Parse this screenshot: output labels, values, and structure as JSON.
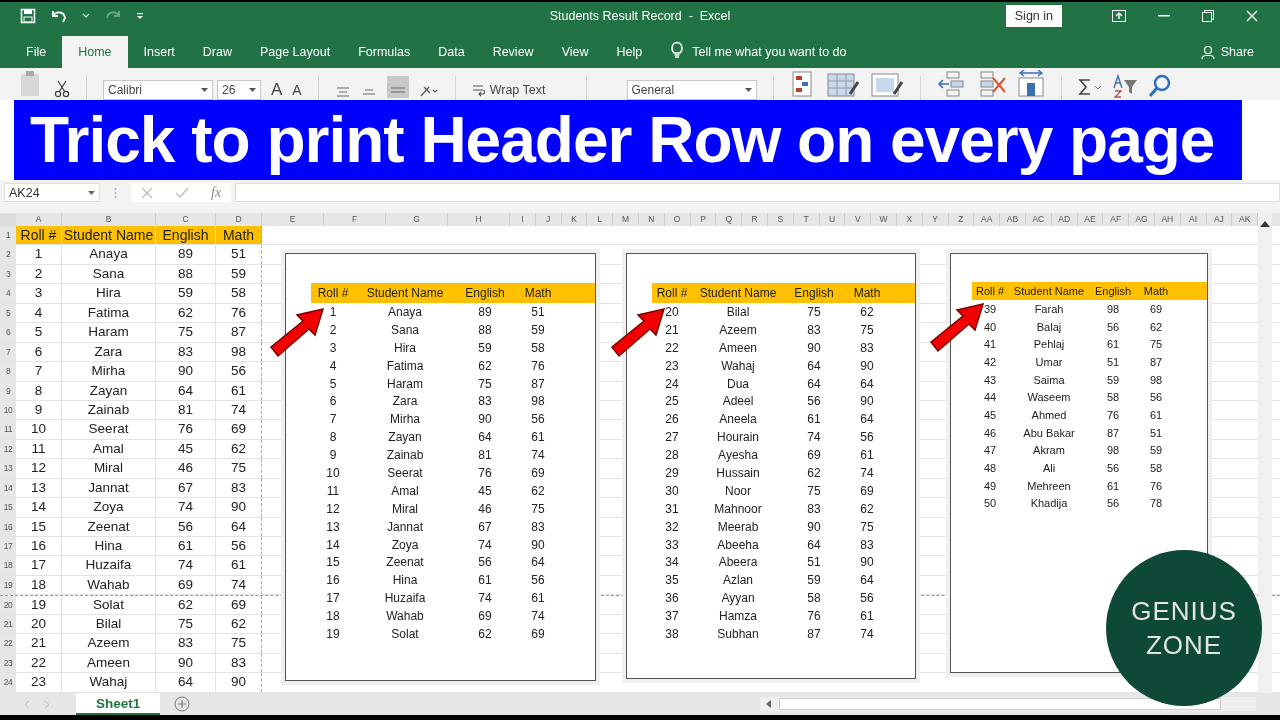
{
  "window": {
    "title": "Students Result Record  -  Excel",
    "sign_in": "Sign in"
  },
  "ribbon_tabs": [
    {
      "label": "File",
      "selected": false
    },
    {
      "label": "Home",
      "selected": true
    },
    {
      "label": "Insert",
      "selected": false
    },
    {
      "label": "Draw",
      "selected": false
    },
    {
      "label": "Page Layout",
      "selected": false
    },
    {
      "label": "Formulas",
      "selected": false
    },
    {
      "label": "Data",
      "selected": false
    },
    {
      "label": "Review",
      "selected": false
    },
    {
      "label": "View",
      "selected": false
    },
    {
      "label": "Help",
      "selected": false
    }
  ],
  "tell_me": "Tell me what you want to do",
  "share": "Share",
  "ribbon": {
    "font": "Calibri",
    "font_size": "26",
    "grow_font": "A",
    "shrink_font": "A",
    "wrap_text": "Wrap Text",
    "number_format": "General"
  },
  "banner": "Trick to print Header Row on every page",
  "formula_bar": {
    "name_box": "AK24",
    "function_label": "fx"
  },
  "grid": {
    "column_letters": [
      "A",
      "B",
      "C",
      "D",
      "E",
      "F",
      "G",
      "H",
      "I",
      "J",
      "K",
      "L",
      "M",
      "N",
      "O",
      "P",
      "Q",
      "R",
      "S",
      "T",
      "U",
      "V",
      "W",
      "X",
      "Y",
      "Z",
      "AA",
      "AB",
      "AC",
      "AD",
      "AE",
      "AF",
      "AG",
      "AH",
      "AI",
      "AJ",
      "AK"
    ],
    "row_numbers": [
      "1",
      "2",
      "3",
      "4",
      "5",
      "6",
      "7",
      "8",
      "9",
      "10",
      "11",
      "12",
      "13",
      "14",
      "15",
      "16",
      "17",
      "18",
      "19",
      "20",
      "21",
      "22",
      "23",
      "24"
    ],
    "header": [
      "Roll #",
      "Student Name",
      "English",
      "Math"
    ],
    "rows": [
      [
        "1",
        "Anaya",
        "89",
        "51"
      ],
      [
        "2",
        "Sana",
        "88",
        "59"
      ],
      [
        "3",
        "Hira",
        "59",
        "58"
      ],
      [
        "4",
        "Fatima",
        "62",
        "76"
      ],
      [
        "5",
        "Haram",
        "75",
        "87"
      ],
      [
        "6",
        "Zara",
        "83",
        "98"
      ],
      [
        "7",
        "Mirha",
        "90",
        "56"
      ],
      [
        "8",
        "Zayan",
        "64",
        "61"
      ],
      [
        "9",
        "Zainab",
        "81",
        "74"
      ],
      [
        "10",
        "Seerat",
        "76",
        "69"
      ],
      [
        "11",
        "Amal",
        "45",
        "62"
      ],
      [
        "12",
        "Miral",
        "46",
        "75"
      ],
      [
        "13",
        "Jannat",
        "67",
        "83"
      ],
      [
        "14",
        "Zoya",
        "74",
        "90"
      ],
      [
        "15",
        "Zeenat",
        "56",
        "64"
      ],
      [
        "16",
        "Hina",
        "61",
        "56"
      ],
      [
        "17",
        "Huzaifa",
        "74",
        "61"
      ],
      [
        "18",
        "Wahab",
        "69",
        "74"
      ],
      [
        "19",
        "Solat",
        "62",
        "69"
      ],
      [
        "20",
        "Bilal",
        "75",
        "62"
      ],
      [
        "21",
        "Azeem",
        "83",
        "75"
      ],
      [
        "22",
        "Ameen",
        "90",
        "83"
      ],
      [
        "23",
        "Wahaj",
        "64",
        "90"
      ]
    ]
  },
  "pages": [
    {
      "header": [
        "Roll #",
        "Student Name",
        "English",
        "Math"
      ],
      "rows": [
        [
          "1",
          "Anaya",
          "89",
          "51"
        ],
        [
          "2",
          "Sana",
          "88",
          "59"
        ],
        [
          "3",
          "Hira",
          "59",
          "58"
        ],
        [
          "4",
          "Fatima",
          "62",
          "76"
        ],
        [
          "5",
          "Haram",
          "75",
          "87"
        ],
        [
          "6",
          "Zara",
          "83",
          "98"
        ],
        [
          "7",
          "Mirha",
          "90",
          "56"
        ],
        [
          "8",
          "Zayan",
          "64",
          "61"
        ],
        [
          "9",
          "Zainab",
          "81",
          "74"
        ],
        [
          "10",
          "Seerat",
          "76",
          "69"
        ],
        [
          "11",
          "Amal",
          "45",
          "62"
        ],
        [
          "12",
          "Miral",
          "46",
          "75"
        ],
        [
          "13",
          "Jannat",
          "67",
          "83"
        ],
        [
          "14",
          "Zoya",
          "74",
          "90"
        ],
        [
          "15",
          "Zeenat",
          "56",
          "64"
        ],
        [
          "16",
          "Hina",
          "61",
          "56"
        ],
        [
          "17",
          "Huzaifa",
          "74",
          "61"
        ],
        [
          "18",
          "Wahab",
          "69",
          "74"
        ],
        [
          "19",
          "Solat",
          "62",
          "69"
        ]
      ]
    },
    {
      "header": [
        "Roll #",
        "Student Name",
        "English",
        "Math"
      ],
      "rows": [
        [
          "20",
          "Bilal",
          "75",
          "62"
        ],
        [
          "21",
          "Azeem",
          "83",
          "75"
        ],
        [
          "22",
          "Ameen",
          "90",
          "83"
        ],
        [
          "23",
          "Wahaj",
          "64",
          "90"
        ],
        [
          "24",
          "Dua",
          "64",
          "64"
        ],
        [
          "25",
          "Adeel",
          "56",
          "90"
        ],
        [
          "26",
          "Aneela",
          "61",
          "64"
        ],
        [
          "27",
          "Hourain",
          "74",
          "56"
        ],
        [
          "28",
          "Ayesha",
          "69",
          "61"
        ],
        [
          "29",
          "Hussain",
          "62",
          "74"
        ],
        [
          "30",
          "Noor",
          "75",
          "69"
        ],
        [
          "31",
          "Mahnoor",
          "83",
          "62"
        ],
        [
          "32",
          "Meerab",
          "90",
          "75"
        ],
        [
          "33",
          "Abeeha",
          "64",
          "83"
        ],
        [
          "34",
          "Abeera",
          "51",
          "90"
        ],
        [
          "35",
          "Azlan",
          "59",
          "64"
        ],
        [
          "36",
          "Ayyan",
          "58",
          "56"
        ],
        [
          "37",
          "Hamza",
          "76",
          "61"
        ],
        [
          "38",
          "Subhan",
          "87",
          "74"
        ]
      ]
    },
    {
      "header": [
        "Roll #",
        "Student Name",
        "English",
        "Math"
      ],
      "rows": [
        [
          "39",
          "Farah",
          "98",
          "69"
        ],
        [
          "40",
          "Balaj",
          "56",
          "62"
        ],
        [
          "41",
          "Pehlaj",
          "61",
          "75"
        ],
        [
          "42",
          "Umar",
          "51",
          "87"
        ],
        [
          "43",
          "Saima",
          "59",
          "98"
        ],
        [
          "44",
          "Waseem",
          "58",
          "56"
        ],
        [
          "45",
          "Ahmed",
          "76",
          "61"
        ],
        [
          "46",
          "Abu Bakar",
          "87",
          "51"
        ],
        [
          "47",
          "Akram",
          "98",
          "59"
        ],
        [
          "48",
          "Ali",
          "56",
          "58"
        ],
        [
          "49",
          "Mehreen",
          "61",
          "76"
        ],
        [
          "50",
          "Khadija",
          "56",
          "78"
        ]
      ]
    }
  ],
  "sheet_tabs": [
    {
      "label": "Sheet1",
      "selected": true
    }
  ],
  "logo": [
    "GENIUS",
    "ZONE"
  ]
}
